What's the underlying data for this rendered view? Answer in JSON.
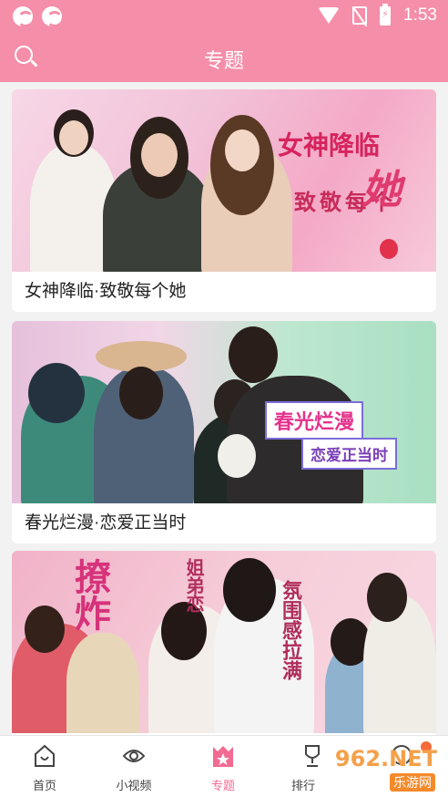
{
  "status_bar": {
    "time": "1:53"
  },
  "header": {
    "title": "专题"
  },
  "topics": [
    {
      "caption": "女神降临·致敬每个她",
      "banner_title": "女神降临",
      "banner_sub1": "致敬每个",
      "banner_sub2": "她"
    },
    {
      "caption": "春光烂漫·恋爱正当时",
      "banner_title": "春光烂漫",
      "banner_sub1": "恋爱正当时"
    },
    {
      "caption": "",
      "banner_title": "撩炸",
      "banner_sub1": "姐弟恋",
      "banner_sub2": "氛围感拉满"
    }
  ],
  "tabs": [
    {
      "label": "首页",
      "icon": "home-icon"
    },
    {
      "label": "小视频",
      "icon": "eye-icon"
    },
    {
      "label": "专题",
      "icon": "crown-star-icon"
    },
    {
      "label": "排行",
      "icon": "trophy-icon"
    },
    {
      "label": "",
      "icon": "profile-icon"
    }
  ],
  "watermark": {
    "brand": "962.NET",
    "sub": "乐游网"
  },
  "colors": {
    "accent": "#f58ea9",
    "active_tab": "#f36b92"
  }
}
